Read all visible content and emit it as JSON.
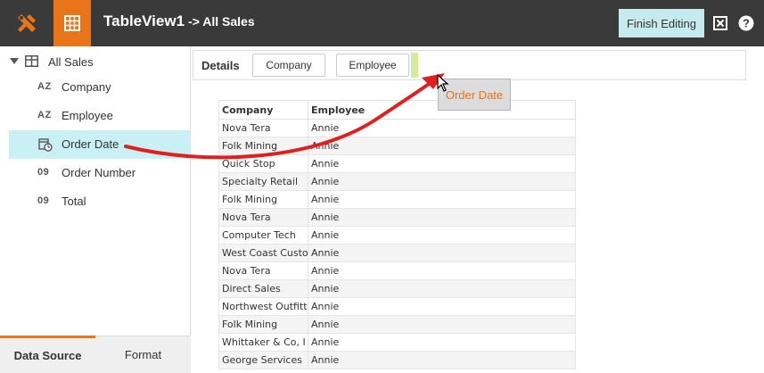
{
  "header": {
    "title": "TableView1",
    "subtitle": "-> All Sales",
    "finish_label": "Finish Editing"
  },
  "sidebar": {
    "root_label": "All Sales",
    "fields": [
      {
        "badge": "AZ",
        "label": "Company"
      },
      {
        "badge": "AZ",
        "label": "Employee"
      },
      {
        "badge": "",
        "label": "Order Date"
      },
      {
        "badge": "09",
        "label": "Order Number"
      },
      {
        "badge": "09",
        "label": "Total"
      }
    ],
    "tabs": [
      "Data Source",
      "Format"
    ]
  },
  "details": {
    "label": "Details",
    "chips": [
      "Company",
      "Employee"
    ]
  },
  "drag": {
    "label": "Order Date"
  },
  "table": {
    "headers": [
      "Company",
      "Employee"
    ],
    "rows": [
      [
        "Nova Tera",
        "Annie"
      ],
      [
        "Folk Mining",
        "Annie"
      ],
      [
        "Quick Stop",
        "Annie"
      ],
      [
        "Specialty Retail",
        "Annie"
      ],
      [
        "Folk Mining",
        "Annie"
      ],
      [
        "Nova Tera",
        "Annie"
      ],
      [
        "Computer Tech",
        "Annie"
      ],
      [
        "West Coast Custo",
        "Annie"
      ],
      [
        "Nova Tera",
        "Annie"
      ],
      [
        "Direct Sales",
        "Annie"
      ],
      [
        "Northwest Outfitt",
        "Annie"
      ],
      [
        "Folk Mining",
        "Annie"
      ],
      [
        "Whittaker & Co, I",
        "Annie"
      ],
      [
        "George Services",
        "Annie"
      ]
    ]
  },
  "colors": {
    "accent": "#e8751a",
    "topbar": "#3a3a3a",
    "selected": "#c9f0f4",
    "finish": "#c6ebef",
    "arrow": "#e02020"
  }
}
